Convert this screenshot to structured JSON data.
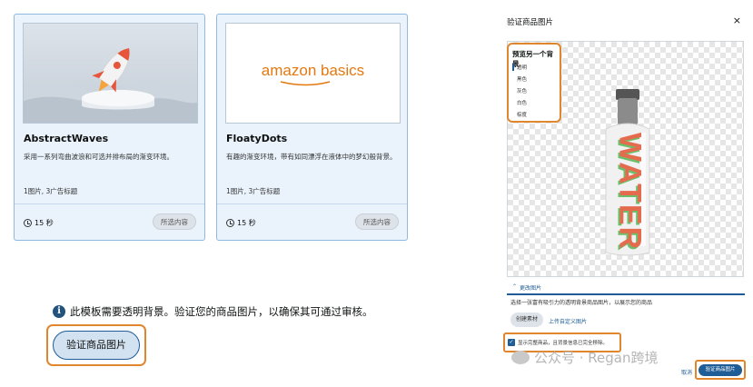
{
  "cards": [
    {
      "title": "AbstractWaves",
      "description": "采用一系列弯曲波浪和可选并排布局的渐变环境。",
      "meta": "1图片, 3广告标题",
      "duration": "15 秒",
      "button": "所选内容",
      "image_icon": "rocket-on-pedestal"
    },
    {
      "title": "FloatyDots",
      "description": "有趣的渐变环境，带有如同漂浮在液体中的梦幻般背景。",
      "meta": "1图片, 3广告标题",
      "duration": "15 秒",
      "button": "所选内容",
      "logo_text": "amazon basics"
    }
  ],
  "notice": {
    "text": "此模板需要透明背景。验证您的商品图片，以确保其可通过审核。",
    "verify_button": "验证商品图片"
  },
  "dialog": {
    "title": "验证商品图片",
    "close": "×",
    "bg_menu": {
      "title": "预览另一个背景",
      "items": [
        "透明",
        "黑色",
        "灰色",
        "白色",
        "棕度"
      ],
      "selected": "透明"
    },
    "bottle_text": "WATER",
    "change_image": "更改图片",
    "instruction": "选择一张富有吸引力的透明背景商品图片，以展示您的商品",
    "create_asset": "创建素材",
    "upload_link": "上传自定义图片",
    "checkbox_label": "显示完整商品，且背景信息已完全移除。",
    "checkbox_checked": true,
    "cancel": "取消",
    "primary_button": "验证商品图片"
  },
  "watermark": "公众号 · Regan跨境",
  "colors": {
    "highlight": "#e0862f",
    "primary": "#1f5d96",
    "card_bg": "#eaf3fc"
  }
}
